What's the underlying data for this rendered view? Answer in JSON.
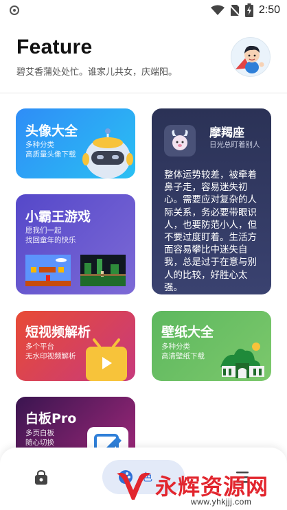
{
  "status_bar": {
    "time": "2:50"
  },
  "header": {
    "title": "Feature",
    "subtitle": "碧艾香蒲处处忙。谁家儿共女，庆端阳。"
  },
  "cards": {
    "avatar": {
      "title": "头像大全",
      "desc1": "多种分类",
      "desc2": "高质量头像下载"
    },
    "game": {
      "title": "小霸王游戏",
      "desc1": "愿我们一起",
      "desc2": "找回童年的快乐"
    },
    "zodiac": {
      "name": "摩羯座",
      "date": "日光总盯着别人",
      "text": "整体运势较差，被牵着鼻子走，容易迷失初心。需要应对复杂的人际关系，务必要带眼识人，也要防范小人，但不要过度盯着。生活方面容易攀比中迷失自我，总是过于在意与别人的比较，好胜心太强。"
    },
    "video": {
      "title": "短视频解析",
      "desc1": "多个平台",
      "desc2": "无水印视频解析"
    },
    "wallpaper": {
      "title": "壁纸大全",
      "desc1": "多种分类",
      "desc2": "高清壁纸下载"
    },
    "board": {
      "title": "白板Pro",
      "desc1": "多页白板",
      "desc2": "随心切换"
    }
  },
  "bottom_nav": {
    "active_label": "色"
  },
  "watermark": {
    "text": "永辉资源网",
    "url": "www.yhkjjj.com"
  },
  "icons": {
    "status_left": "app-notification-icon",
    "wifi": "wifi-icon",
    "no_sim": "no-sim-icon",
    "battery": "battery-charging-icon",
    "nav_left": "shopping-bag-icon",
    "nav_right": "menu-icon"
  },
  "colors": {
    "accent": "#2f6fd6",
    "watermark_red": "#e2262e"
  }
}
